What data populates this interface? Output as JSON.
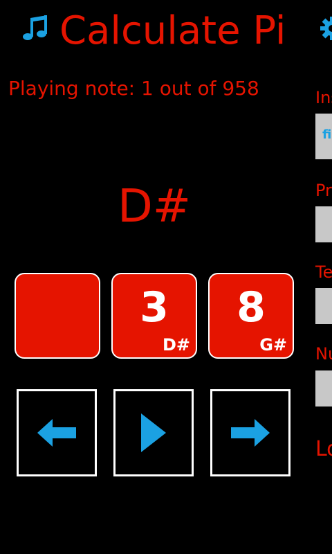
{
  "app": {
    "title": "Calculate Pi",
    "music_icon": "music-note-icon",
    "settings_icon": "gear-icon",
    "accent_color": "#E51400",
    "icon_color": "#1BA1E2"
  },
  "status": {
    "text": "Playing note: 1 out of 958"
  },
  "current_note": "D#",
  "tiles": [
    {
      "digit": "",
      "note": ""
    },
    {
      "digit": "3",
      "note": "D#"
    },
    {
      "digit": "8",
      "note": "G#"
    }
  ],
  "controls": {
    "previous_icon": "arrow-left-icon",
    "play_icon": "play-icon",
    "next_icon": "arrow-right-icon"
  },
  "side_panel": {
    "instrument_label": "Ins",
    "instrument_value": "fi",
    "precision_label": "Pr",
    "tempo_label": "Te",
    "number_label": "Nu",
    "link_label": "Lo"
  }
}
